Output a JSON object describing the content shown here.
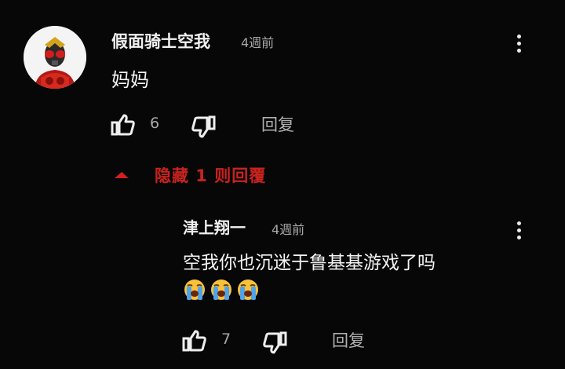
{
  "comment": {
    "author": "假面骑士空我",
    "time": "4週前",
    "text": "妈妈",
    "likes": "6",
    "reply_label": "回复"
  },
  "replies_toggle": {
    "label": "隐藏 1 则回覆"
  },
  "reply": {
    "author": "津上翔一",
    "time": "4週前",
    "text": "空我你也沉迷于鲁基基游戏了吗",
    "emojis": [
      "loudly-crying-face",
      "loudly-crying-face",
      "loudly-crying-face"
    ],
    "likes": "7",
    "reply_label": "回复"
  },
  "colors": {
    "background": "#070707",
    "accent_red": "#c8231f",
    "secondary_text": "#a8a8a8"
  }
}
